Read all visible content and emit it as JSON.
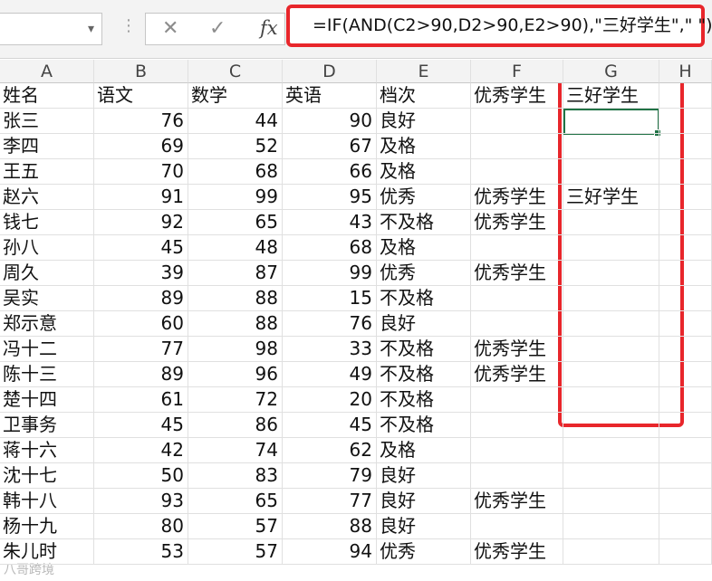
{
  "formula_bar": {
    "name_box": "",
    "cancel_icon": "✕",
    "enter_icon": "✓",
    "fx_label": "fx",
    "formula": "=IF(AND(C2>90,D2>90,E2>90),\"三好学生\",\" \")"
  },
  "sheet": {
    "columns": [
      "A",
      "B",
      "C",
      "D",
      "E",
      "F",
      "G",
      "H"
    ],
    "header_row": [
      "姓名",
      "语文",
      "数学",
      "英语",
      "档次",
      "优秀学生",
      "三好学生"
    ],
    "rows": [
      [
        "张三",
        "76",
        "44",
        "90",
        "良好",
        "",
        ""
      ],
      [
        "李四",
        "69",
        "52",
        "67",
        "及格",
        "",
        ""
      ],
      [
        "王五",
        "70",
        "68",
        "66",
        "及格",
        "",
        ""
      ],
      [
        "赵六",
        "91",
        "99",
        "95",
        "优秀",
        "优秀学生",
        "三好学生"
      ],
      [
        "钱七",
        "92",
        "65",
        "43",
        "不及格",
        "优秀学生",
        ""
      ],
      [
        "孙八",
        "45",
        "48",
        "68",
        "及格",
        "",
        ""
      ],
      [
        "周久",
        "39",
        "87",
        "99",
        "优秀",
        "优秀学生",
        ""
      ],
      [
        "吴实",
        "89",
        "88",
        "15",
        "不及格",
        "",
        ""
      ],
      [
        "郑示意",
        "60",
        "88",
        "76",
        "良好",
        "",
        ""
      ],
      [
        "冯十二",
        "77",
        "98",
        "33",
        "不及格",
        "优秀学生",
        ""
      ],
      [
        "陈十三",
        "89",
        "96",
        "49",
        "不及格",
        "优秀学生",
        ""
      ],
      [
        "楚十四",
        "61",
        "72",
        "20",
        "不及格",
        "",
        ""
      ],
      [
        "卫事务",
        "45",
        "86",
        "45",
        "不及格",
        "",
        ""
      ],
      [
        "蒋十六",
        "42",
        "74",
        "62",
        "及格",
        "",
        ""
      ],
      [
        "沈十七",
        "50",
        "83",
        "79",
        "良好",
        "",
        ""
      ],
      [
        "韩十八",
        "93",
        "65",
        "77",
        "良好",
        "优秀学生",
        ""
      ],
      [
        "杨十九",
        "80",
        "57",
        "88",
        "良好",
        "",
        ""
      ],
      [
        "朱儿时",
        "53",
        "57",
        "94",
        "优秀",
        "优秀学生",
        ""
      ]
    ]
  },
  "selected_cell": "G2",
  "watermark": "八哥跨境",
  "colors": {
    "highlight": "#e8262b",
    "selection": "#217346"
  }
}
